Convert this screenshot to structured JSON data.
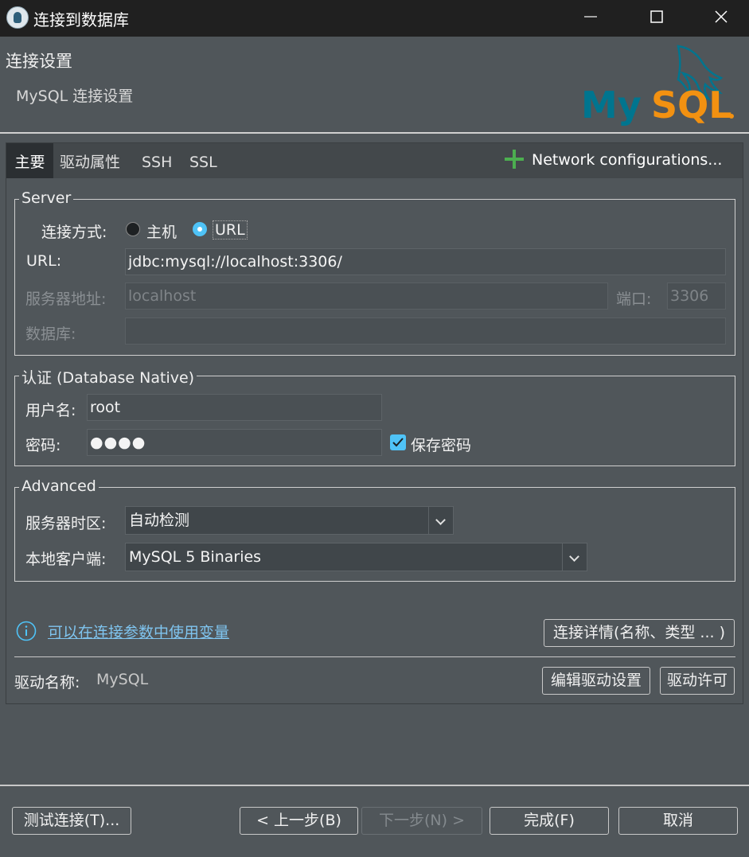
{
  "window": {
    "title": "连接到数据库"
  },
  "header": {
    "title": "连接设置",
    "subtitle": "MySQL 连接设置",
    "logo_text": "MySQL"
  },
  "tabs": [
    {
      "label": "主要",
      "active": true
    },
    {
      "label": "驱动属性"
    },
    {
      "label": "SSH"
    },
    {
      "label": "SSL"
    }
  ],
  "network_config_label": "Network configurations...",
  "server": {
    "legend": "Server",
    "connect_mode_label": "连接方式:",
    "mode_host": "主机",
    "mode_url": "URL",
    "selected_mode": "URL",
    "url_label": "URL:",
    "url_value": "jdbc:mysql://localhost:3306/",
    "host_label": "服务器地址:",
    "host_value": "localhost",
    "port_label": "端口:",
    "port_value": "3306",
    "database_label": "数据库:",
    "database_value": ""
  },
  "auth": {
    "legend": "认证 (Database Native)",
    "username_label": "用户名:",
    "username_value": "root",
    "password_label": "密码:",
    "password_value": "●●●●",
    "save_password_label": "保存密码",
    "save_password_checked": true
  },
  "advanced": {
    "legend": "Advanced",
    "timezone_label": "服务器时区:",
    "timezone_value": "自动检测",
    "client_label": "本地客户端:",
    "client_value": "MySQL 5 Binaries"
  },
  "variables_link": "可以在连接参数中使用变量",
  "connection_details_button": "连接详情(名称、类型 ... )",
  "driver": {
    "label": "驱动名称:",
    "value": "MySQL",
    "edit_button": "编辑驱动设置",
    "license_button": "驱动许可"
  },
  "footer": {
    "test_button": "测试连接(T)...",
    "back_button": "< 上一步(B)",
    "next_button": "下一步(N) >",
    "finish_button": "完成(F)",
    "cancel_button": "取消"
  },
  "colors": {
    "accent": "#4fc3f7",
    "link": "#7fc4ef",
    "plus": "#4caf50",
    "mysql_blue": "#00758f",
    "mysql_orange": "#f29111"
  }
}
